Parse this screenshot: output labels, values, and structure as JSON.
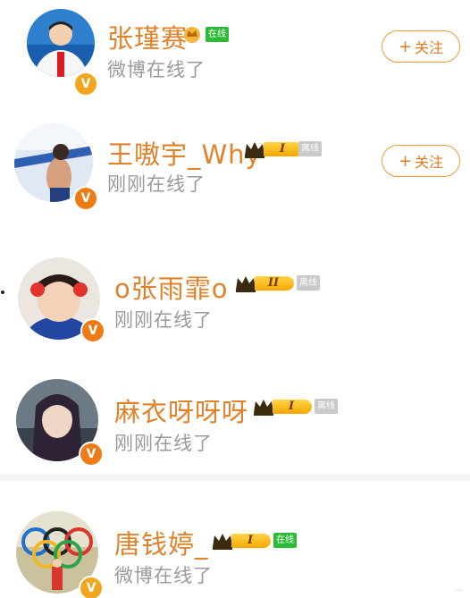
{
  "users": [
    {
      "name": "张瑾赛",
      "status": "微博在线了",
      "tag": "在线",
      "tag_type": "online",
      "vip": "",
      "follow_label": "关注",
      "follow_icon": "plus-icon",
      "verified_icon": "v-badge-icon"
    },
    {
      "name": "王嗷宇_Why",
      "status": "刚刚在线了",
      "tag": "离线",
      "tag_type": "offline",
      "vip": "I",
      "follow_label": "关注",
      "follow_icon": "plus-icon",
      "verified_icon": "v-badge-icon"
    },
    {
      "name": "o张雨霏o",
      "status": "刚刚在线了",
      "tag": "离线",
      "tag_type": "offline",
      "vip": "II",
      "verified_icon": "v-badge-icon"
    },
    {
      "name": "麻衣呀呀呀",
      "status": "刚刚在线了",
      "tag": "离线",
      "tag_type": "offline",
      "vip": "I",
      "verified_icon": "v-badge-icon"
    },
    {
      "name": "唐钱婷_",
      "status": "微博在线了",
      "tag": "在线",
      "tag_type": "online",
      "vip": "I",
      "verified_icon": "v-badge-icon"
    }
  ],
  "colors": {
    "name": "#e0822a",
    "status": "#9a9a9a",
    "online": "#2dbb37",
    "offline": "#c9c9c9",
    "follow_border": "#f09a3e",
    "vip": "#f6a800"
  }
}
